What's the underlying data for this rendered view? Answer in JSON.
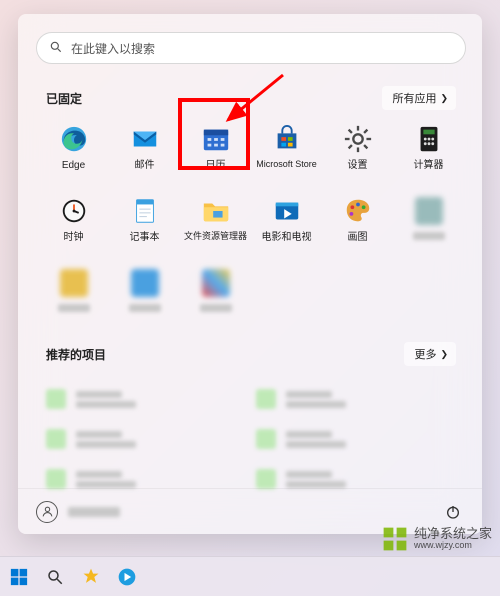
{
  "search": {
    "placeholder": "在此键入以搜索"
  },
  "pinned": {
    "title": "已固定",
    "all_apps": "所有应用",
    "items": [
      {
        "name": "edge",
        "label": "Edge"
      },
      {
        "name": "mail",
        "label": "邮件"
      },
      {
        "name": "calendar",
        "label": "日历"
      },
      {
        "name": "store",
        "label": "Microsoft Store"
      },
      {
        "name": "settings",
        "label": "设置"
      },
      {
        "name": "calculator",
        "label": "计算器"
      },
      {
        "name": "clock",
        "label": "时钟"
      },
      {
        "name": "notepad",
        "label": "记事本"
      },
      {
        "name": "explorer",
        "label": "文件资源管理器"
      },
      {
        "name": "movies",
        "label": "电影和电视"
      },
      {
        "name": "paint",
        "label": "画图"
      }
    ]
  },
  "recommended": {
    "title": "推荐的项目",
    "more": "更多"
  },
  "watermark": {
    "line1": "纯净系统之家",
    "line2": "www.wjzy.com"
  },
  "colors": {
    "highlight": "#ff0000",
    "edge": "#2779c6",
    "mail": "#0078d4",
    "calendar": "#2a6fd6",
    "store": "#00a4ef",
    "settings": "#5b5b5b",
    "calculator": "#1c1c1c",
    "clock": "#1b1b1b",
    "notepad": "#3aa0e0",
    "explorer": "#f8c146",
    "movies": "#0f6bb8",
    "paint": "#e8a33d"
  }
}
